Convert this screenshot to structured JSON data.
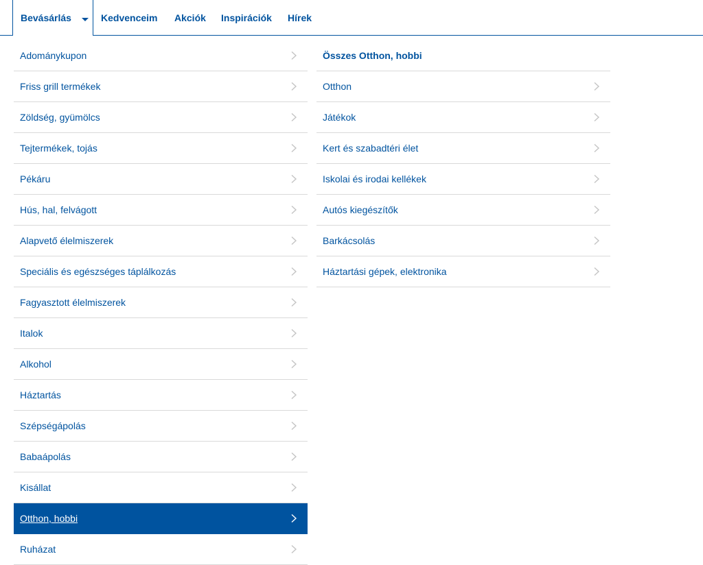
{
  "nav": {
    "active_tab": "Bevásárlás",
    "links": [
      "Kedvenceim",
      "Akciók",
      "Inspirációk",
      "Hírek"
    ]
  },
  "left_menu": {
    "items": [
      "Adománykupon",
      "Friss grill termékek",
      "Zöldség, gyümölcs",
      "Tejtermékek, tojás",
      "Pékáru",
      "Hús, hal, felvágott",
      "Alapvető élelmiszerek",
      "Speciális és egészséges táplálkozás",
      "Fagyasztott élelmiszerek",
      "Italok",
      "Alkohol",
      "Háztartás",
      "Szépségápolás",
      "Babaápolás",
      "Kisállat",
      "Otthon, hobbi",
      "Ruházat"
    ],
    "selected_index": 15
  },
  "right_menu": {
    "header": "Összes Otthon, hobbi",
    "items": [
      "Otthon",
      "Játékok",
      "Kert és szabadtéri élet",
      "Iskolai és irodai kellékek",
      "Autós kiegészítők",
      "Barkácsolás",
      "Háztartási gépek, elektronika"
    ]
  },
  "colors": {
    "brand_blue": "#00539f",
    "divider": "#d9d9d9",
    "chevron": "#c4c4c4"
  }
}
